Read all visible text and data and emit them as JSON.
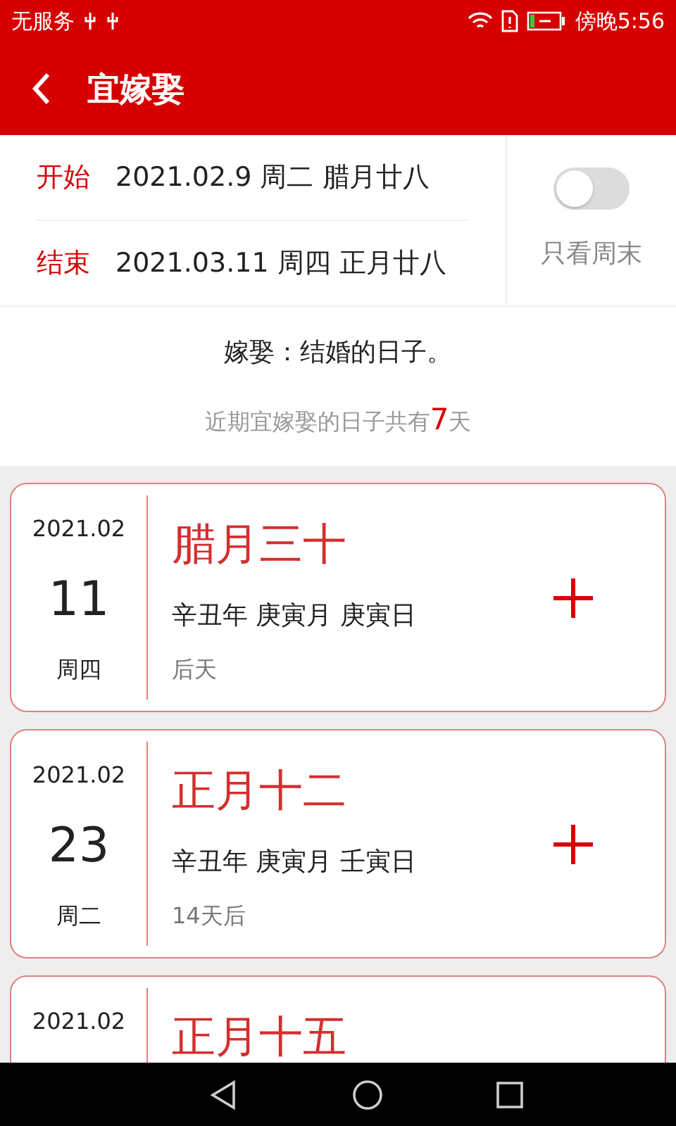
{
  "status_bar": {
    "carrier": "无服务",
    "time": "傍晚5:56"
  },
  "header": {
    "title": "宜嫁娶"
  },
  "range": {
    "rows": [
      {
        "label": "开始",
        "value": "2021.02.9 周二 腊月廿八"
      },
      {
        "label": "结束",
        "value": "2021.03.11 周四 正月廿八"
      }
    ],
    "weekend_only": {
      "label": "只看周末",
      "on": false
    }
  },
  "info": {
    "definition": "嫁娶：结婚的日子。",
    "count_prefix": "近期宜嫁娶的日子共有",
    "count": "7",
    "count_suffix": "天"
  },
  "days": [
    {
      "month": "2021.02",
      "day": "11",
      "weekday": "周四",
      "lunar": "腊月三十",
      "ganzhi": "辛丑年 庚寅月 庚寅日",
      "relative": "后天"
    },
    {
      "month": "2021.02",
      "day": "23",
      "weekday": "周二",
      "lunar": "正月十二",
      "ganzhi": "辛丑年 庚寅月 壬寅日",
      "relative": "14天后"
    },
    {
      "month": "2021.02",
      "lunar": "正月十五"
    }
  ]
}
